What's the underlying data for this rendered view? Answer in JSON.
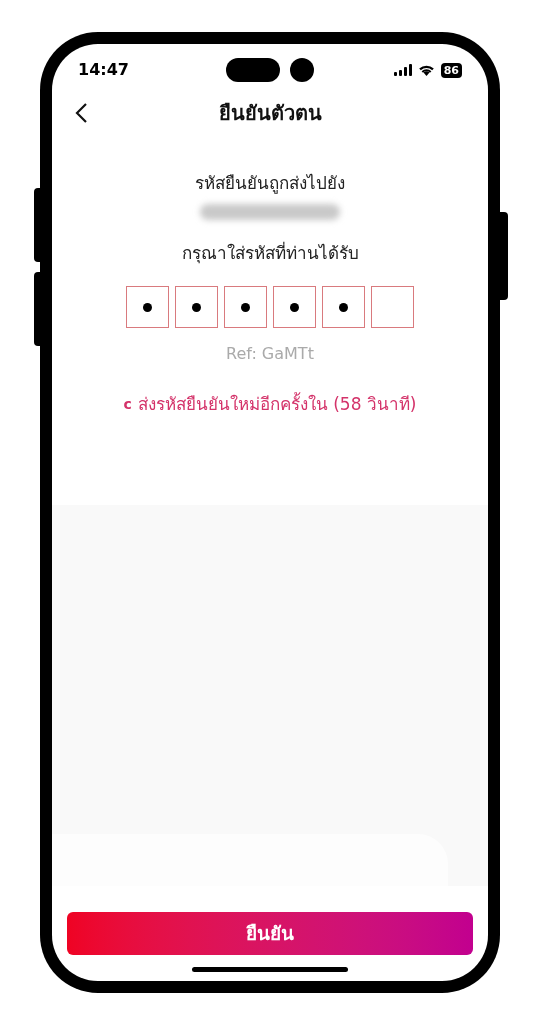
{
  "status_bar": {
    "time": "14:47",
    "battery": "86"
  },
  "header": {
    "title": "ยืนยันตัวตน"
  },
  "sent_to": {
    "label": "รหัสยืนยันถูกส่งไปยัง",
    "phone_redacted": true
  },
  "otp": {
    "prompt": "กรุณาใส่รหัสที่ท่านได้รับ",
    "cells": [
      {
        "filled": true
      },
      {
        "filled": true
      },
      {
        "filled": true
      },
      {
        "filled": true
      },
      {
        "filled": true
      },
      {
        "filled": false
      }
    ],
    "ref": "Ref: GaMTt"
  },
  "resend": {
    "icon": "c",
    "label": "ส่งรหัสยืนยันใหม่อีกครั้งใน (58 วินาที)"
  },
  "confirm_button": "ยืนยัน"
}
